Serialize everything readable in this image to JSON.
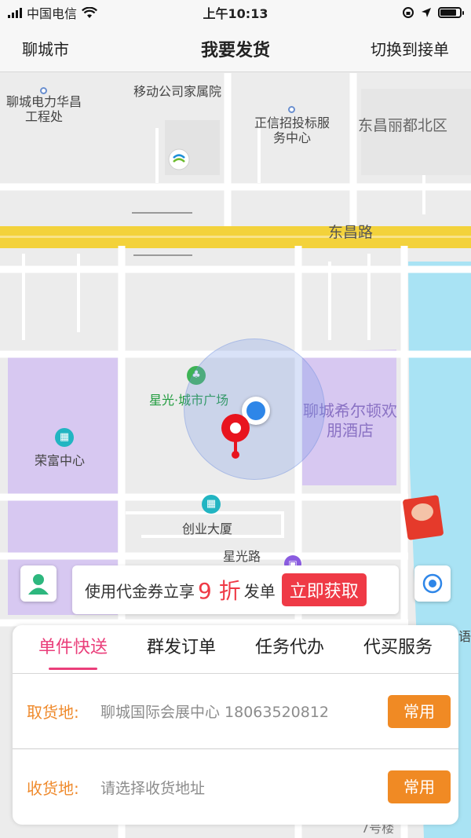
{
  "status_bar": {
    "carrier": "中国电信",
    "time": "上午10:13",
    "battery_level": 0.85
  },
  "navbar": {
    "city": "聊城市",
    "title": "我要发货",
    "switch_label": "切换到接单"
  },
  "map": {
    "labels": {
      "mobile_family": "移动公司家属院",
      "power_company": "聊城电力华昌工程处",
      "zhengxin": "正信招投标服务中心",
      "dongchang_lidu": "东昌丽都北区",
      "dongchang_road": "东昌路",
      "xingguang_plaza": "星光·城市广场",
      "hilton": "聊城希尔顿欢朋酒店",
      "rongfu": "荣富中心",
      "chuangye": "创业大厦",
      "xingguang_road": "星光路",
      "partial_right": "语",
      "partial_bottom": "7号楼"
    }
  },
  "coupon": {
    "prefix": "使用代金券立享",
    "discount": "9 折",
    "suffix": "发单",
    "button": "立即获取"
  },
  "panel": {
    "tabs": [
      {
        "label": "单件快送",
        "active": true
      },
      {
        "label": "群发订单",
        "active": false
      },
      {
        "label": "任务代办",
        "active": false
      },
      {
        "label": "代买服务",
        "active": false
      }
    ],
    "pickup": {
      "label": "取货地:",
      "value": "聊城国际会展中心   18063520812",
      "button": "常用"
    },
    "delivery": {
      "label": "收货地:",
      "placeholder": "请选择收货地址",
      "button": "常用"
    }
  },
  "colors": {
    "accent_pink": "#ea3e7a",
    "accent_orange": "#f08a24",
    "coupon_red": "#ef3a46",
    "location_blue": "#2e86e8",
    "pin_red": "#e8141e",
    "road_yellow": "#f3d23b"
  }
}
